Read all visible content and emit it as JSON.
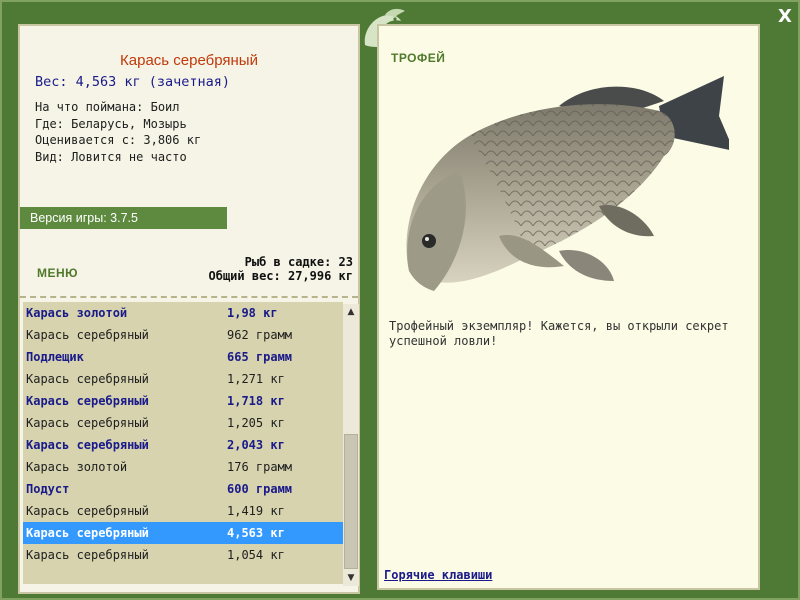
{
  "window": {
    "close_label": "X"
  },
  "fish_info": {
    "title": "Карась серебряный",
    "weight_line": "Вес: 4,563 кг (зачетная)",
    "details": [
      "На что поймана: Боил",
      "Где: Беларусь, Мозырь",
      "Оценивается с: 3,806 кг",
      "Вид: Ловится не часто"
    ]
  },
  "version": {
    "label": "Версия игры: 3.7.5"
  },
  "menu": {
    "label": "МЕНЮ"
  },
  "keep_stats": {
    "count_line": "Рыб в садке: 23",
    "total_weight_line": "Общий вес: 27,996 кг"
  },
  "catch_list": [
    {
      "name": "Карась золотой",
      "weight": "1,98 кг",
      "bold": true,
      "selected": false
    },
    {
      "name": "Карась серебряный",
      "weight": "962 грамм",
      "bold": false,
      "selected": false
    },
    {
      "name": "Подлещик",
      "weight": "665 грамм",
      "bold": true,
      "selected": false
    },
    {
      "name": "Карась серебряный",
      "weight": "1,271 кг",
      "bold": false,
      "selected": false
    },
    {
      "name": "Карась серебряный",
      "weight": "1,718 кг",
      "bold": true,
      "selected": false
    },
    {
      "name": "Карась серебряный",
      "weight": "1,205 кг",
      "bold": false,
      "selected": false
    },
    {
      "name": "Карась серебряный",
      "weight": "2,043 кг",
      "bold": true,
      "selected": false
    },
    {
      "name": "Карась золотой",
      "weight": "176 грамм",
      "bold": false,
      "selected": false
    },
    {
      "name": "Подуст",
      "weight": "600 грамм",
      "bold": true,
      "selected": false
    },
    {
      "name": "Карась серебряный",
      "weight": "1,419 кг",
      "bold": false,
      "selected": false
    },
    {
      "name": "Карась серебряный",
      "weight": "4,563 кг",
      "bold": true,
      "selected": true
    },
    {
      "name": "Карась серебряный",
      "weight": "1,054 кг",
      "bold": false,
      "selected": false
    }
  ],
  "trophy": {
    "label": "ТРОФЕЙ",
    "description": "Трофейный экземпляр! Кажется, вы открыли секрет успешной ловли!"
  },
  "hotkeys": {
    "label": "Горячие клавиши"
  },
  "icons": {
    "close": "close-icon",
    "emblem": "fish-emblem-icon",
    "scroll_up": "scroll-up-arrow-icon",
    "scroll_down": "scroll-down-arrow-icon"
  },
  "colors": {
    "frame_green": "#4f7a35",
    "panel_bg": "#f5f4e6",
    "list_bg": "#d6d3ae",
    "selection": "#3399ff",
    "title_red": "#c0390b",
    "text_navy": "#1a1a8a"
  }
}
